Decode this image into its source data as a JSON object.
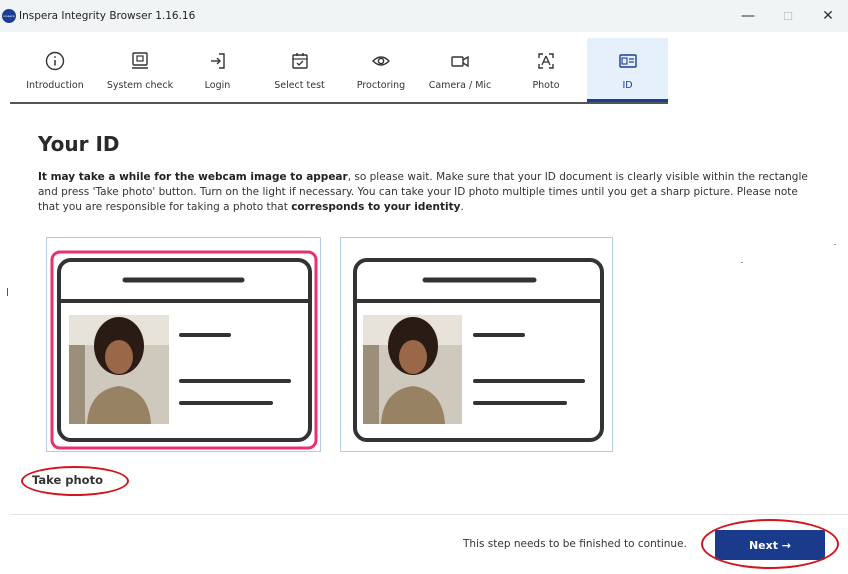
{
  "window": {
    "title": "Inspera Integrity Browser 1.16.16",
    "logo_text": "inspera",
    "controls": {
      "minimize": "—",
      "maximize": "☐",
      "close": "✕"
    }
  },
  "steps": [
    {
      "label": "Introduction",
      "icon": "info-icon"
    },
    {
      "label": "System check",
      "icon": "monitor-icon"
    },
    {
      "label": "Login",
      "icon": "login-icon"
    },
    {
      "label": "Select test",
      "icon": "calendar-check-icon"
    },
    {
      "label": "Proctoring",
      "icon": "eye-icon"
    },
    {
      "label": "Camera / Mic",
      "icon": "camera-icon"
    },
    {
      "label": "Photo",
      "icon": "face-scan-icon"
    },
    {
      "label": "ID",
      "icon": "id-card-icon",
      "active": true
    }
  ],
  "page": {
    "title": "Your ID",
    "instructions": {
      "part1_bold": "It may take a while for the webcam image to appear",
      "part2": ", so please wait. Make sure that your ID document is clearly visible within the rectangle and press 'Take photo' button. Turn on the light if necessary. You can take your ID photo multiple times until you get a sharp picture. Please note that you are responsible for taking a photo that ",
      "part3_bold": "corresponds to your identity",
      "part4": "."
    },
    "take_photo_label": "Take photo"
  },
  "footer": {
    "message": "This step needs to be finished to continue.",
    "next_label": "Next →"
  },
  "colors": {
    "accent": "#1c3f95",
    "highlight": "#d0161e",
    "frame_pink": "#e8326e",
    "panel_border": "#b5cde3"
  }
}
